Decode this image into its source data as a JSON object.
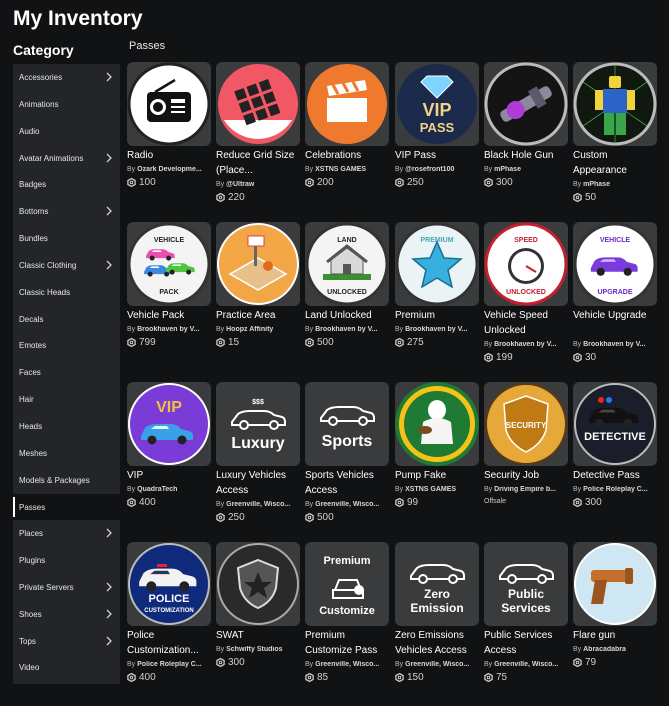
{
  "page_title": "My Inventory",
  "category_title": "Category",
  "section_title": "Passes",
  "sidebar": {
    "active": "Passes",
    "items": [
      {
        "label": "Accessories",
        "chevron": true
      },
      {
        "label": "Animations",
        "chevron": false
      },
      {
        "label": "Audio",
        "chevron": false
      },
      {
        "label": "Avatar Animations",
        "chevron": true
      },
      {
        "label": "Badges",
        "chevron": false
      },
      {
        "label": "Bottoms",
        "chevron": true
      },
      {
        "label": "Bundles",
        "chevron": false
      },
      {
        "label": "Classic Clothing",
        "chevron": true
      },
      {
        "label": "Classic Heads",
        "chevron": false
      },
      {
        "label": "Decals",
        "chevron": false
      },
      {
        "label": "Emotes",
        "chevron": false
      },
      {
        "label": "Faces",
        "chevron": false
      },
      {
        "label": "Hair",
        "chevron": false
      },
      {
        "label": "Heads",
        "chevron": false
      },
      {
        "label": "Meshes",
        "chevron": false
      },
      {
        "label": "Models & Packages",
        "chevron": false
      },
      {
        "label": "Passes",
        "chevron": false
      },
      {
        "label": "Places",
        "chevron": true
      },
      {
        "label": "Plugins",
        "chevron": false
      },
      {
        "label": "Private Servers",
        "chevron": true
      },
      {
        "label": "Shoes",
        "chevron": true
      },
      {
        "label": "Tops",
        "chevron": true
      },
      {
        "label": "Video",
        "chevron": false
      }
    ]
  },
  "by_label": "By",
  "items": [
    {
      "name": "Radio",
      "creator": "Ozark Developme...",
      "price": "100",
      "icon": "radio-icon",
      "lines": 1
    },
    {
      "name": "Reduce Grid Size (Place...",
      "creator": "@Ultraw",
      "price": "220",
      "icon": "grid-icon",
      "lines": 2
    },
    {
      "name": "Celebrations",
      "creator": "XSTNS GAMES",
      "price": "200",
      "icon": "clapperboard-icon",
      "lines": 1
    },
    {
      "name": "VIP Pass",
      "creator": "@rosefront100",
      "price": "250",
      "icon": "vip-pass-icon",
      "lines": 1,
      "thumb_text": [
        "VIP",
        "PASS"
      ]
    },
    {
      "name": "Black Hole Gun",
      "creator": "mPhase",
      "price": "300",
      "icon": "black-hole-gun-icon",
      "lines": 1
    },
    {
      "name": "Custom Appearance",
      "creator": "mPhase",
      "price": "50",
      "icon": "custom-appearance-icon",
      "lines": 2
    },
    {
      "name": "Vehicle Pack",
      "creator": "Brookhaven by V...",
      "price": "799",
      "icon": "vehicle-pack-icon",
      "lines": 1,
      "thumb_text": [
        "VEHICLE",
        "PACK"
      ]
    },
    {
      "name": "Practice Area",
      "creator": "Hoopz Affinity",
      "price": "15",
      "icon": "practice-area-icon",
      "lines": 1
    },
    {
      "name": "Land Unlocked",
      "creator": "Brookhaven by V...",
      "price": "500",
      "icon": "land-unlocked-icon",
      "lines": 1,
      "thumb_text": [
        "LAND",
        "UNLOCKED"
      ]
    },
    {
      "name": "Premium",
      "creator": "Brookhaven by V...",
      "price": "275",
      "icon": "premium-star-icon",
      "lines": 1,
      "thumb_text": [
        "PREMIUM"
      ]
    },
    {
      "name": "Vehicle Speed Unlocked",
      "creator": "Brookhaven by V...",
      "price": "199",
      "icon": "speedometer-icon",
      "lines": 2,
      "thumb_text": [
        "SPEED",
        "UNLOCKED"
      ]
    },
    {
      "name": "Vehicle Upgrade",
      "creator": "Brookhaven by V...",
      "price": "30",
      "icon": "vehicle-upgrade-icon",
      "lines": 2,
      "thumb_text": [
        "VEHICLE",
        "UPGRADE"
      ]
    },
    {
      "name": "VIP",
      "creator": "QuadraTech",
      "price": "400",
      "icon": "vip-car-icon",
      "lines": 1,
      "thumb_text": [
        "VIP"
      ]
    },
    {
      "name": "Luxury Vehicles Access",
      "creator": "Greenville, Wisco...",
      "price": "250",
      "icon": "luxury-car-icon",
      "lines": 2,
      "thumb_text": [
        "$$$",
        "Luxury"
      ]
    },
    {
      "name": "Sports Vehicles Access",
      "creator": "Greenville, Wisco...",
      "price": "500",
      "icon": "sports-car-icon",
      "lines": 2,
      "thumb_text": [
        "Sports"
      ]
    },
    {
      "name": "Pump Fake",
      "creator": "XSTNS GAMES",
      "price": "99",
      "icon": "football-player-icon",
      "lines": 1
    },
    {
      "name": "Security Job",
      "creator": "Driving Empire b...",
      "price": "",
      "offsale": "Offsale",
      "icon": "security-badge-icon",
      "lines": 1,
      "thumb_text": [
        "SECURITY"
      ]
    },
    {
      "name": "Detective Pass",
      "creator": "Police Roleplay C...",
      "price": "300",
      "icon": "detective-car-icon",
      "lines": 1,
      "thumb_text": [
        "DETECTIVE"
      ]
    },
    {
      "name": "Police Customization...",
      "creator": "Police Roleplay C...",
      "price": "400",
      "icon": "police-car-icon",
      "lines": 2,
      "thumb_text": [
        "POLICE",
        "CUSTOMIZATION"
      ]
    },
    {
      "name": "SWAT",
      "creator": "Schwifty Studios",
      "price": "300",
      "icon": "swat-badge-icon",
      "lines": 1
    },
    {
      "name": "Premium Customize Pass",
      "creator": "Greenville, Wisco...",
      "price": "85",
      "icon": "premium-customize-icon",
      "lines": 2,
      "thumb_text": [
        "Premium",
        "Customize"
      ]
    },
    {
      "name": "Zero Emissions Vehicles Access",
      "creator": "Greenville, Wisco...",
      "price": "150",
      "icon": "zero-emission-icon",
      "lines": 2,
      "thumb_text": [
        "Zero",
        "Emission"
      ]
    },
    {
      "name": "Public Services Access",
      "creator": "Greenville, Wisco...",
      "price": "75",
      "icon": "public-services-icon",
      "lines": 2,
      "thumb_text": [
        "Public",
        "Services"
      ]
    },
    {
      "name": "Flare gun",
      "creator": "Abracadabra",
      "price": "79",
      "icon": "flare-gun-icon",
      "lines": 1
    }
  ]
}
